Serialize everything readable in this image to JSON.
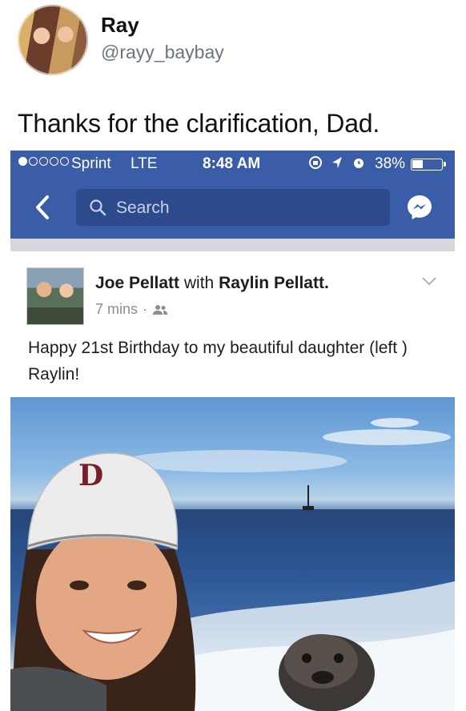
{
  "tweet": {
    "display_name": "Ray",
    "handle": "@rayy_baybay",
    "text": "Thanks for the clarification, Dad."
  },
  "status_bar": {
    "carrier": "Sprint",
    "network": "LTE",
    "time": "8:48 AM",
    "battery": "38%",
    "battery_level": 0.38,
    "signal_bars_filled": 1,
    "signal_bars_total": 5
  },
  "nav": {
    "search_placeholder": "Search",
    "icons": [
      "back-chevron-icon",
      "search-icon",
      "messenger-icon"
    ]
  },
  "post": {
    "author": "Joe Pellatt",
    "with_text": "with",
    "tagged": "Raylin Pellatt.",
    "time": "7 mins",
    "separator": "·",
    "audience_icon": "friends-icon",
    "text": "Happy 21st Birthday to my beautiful daughter (left ) Raylin!"
  },
  "colors": {
    "facebook_blue": "#3b5ca6",
    "search_bg": "#2d4a8c",
    "meta_gray": "#8a8d91"
  }
}
